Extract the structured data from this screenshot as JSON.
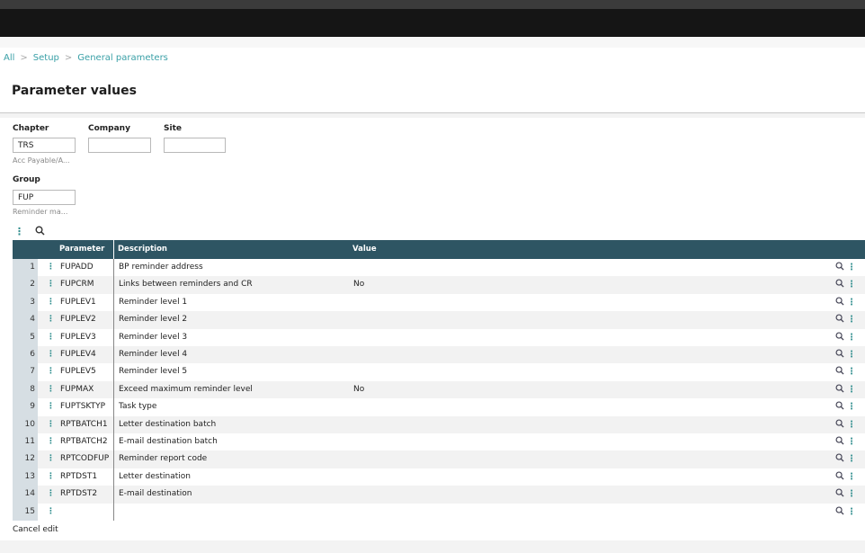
{
  "header": {
    "breadcrumb": [
      "All",
      "Setup",
      "General parameters"
    ],
    "title": "Parameter values"
  },
  "form": {
    "chapter": {
      "label": "Chapter",
      "value": "TRS",
      "description": "Acc Payable/A..."
    },
    "company": {
      "label": "Company",
      "value": ""
    },
    "site": {
      "label": "Site",
      "value": ""
    },
    "group": {
      "label": "Group",
      "value": "FUP",
      "description": "Reminder ma..."
    }
  },
  "table": {
    "columns": [
      "Parameter",
      "Description",
      "Value"
    ],
    "rows": [
      {
        "num": "1",
        "param": "FUPADD",
        "desc": "BP reminder address",
        "value": ""
      },
      {
        "num": "2",
        "param": "FUPCRM",
        "desc": "Links between reminders and CR",
        "value": "No"
      },
      {
        "num": "3",
        "param": "FUPLEV1",
        "desc": "Reminder level 1",
        "value": ""
      },
      {
        "num": "4",
        "param": "FUPLEV2",
        "desc": "Reminder level 2",
        "value": ""
      },
      {
        "num": "5",
        "param": "FUPLEV3",
        "desc": "Reminder level 3",
        "value": ""
      },
      {
        "num": "6",
        "param": "FUPLEV4",
        "desc": "Reminder level 4",
        "value": ""
      },
      {
        "num": "7",
        "param": "FUPLEV5",
        "desc": "Reminder level 5",
        "value": ""
      },
      {
        "num": "8",
        "param": "FUPMAX",
        "desc": "Exceed maximum reminder level",
        "value": "No"
      },
      {
        "num": "9",
        "param": "FUPTSKTYP",
        "desc": "Task type",
        "value": ""
      },
      {
        "num": "10",
        "param": "RPTBATCH1",
        "desc": "Letter destination batch",
        "value": ""
      },
      {
        "num": "11",
        "param": "RPTBATCH2",
        "desc": "E-mail destination batch",
        "value": ""
      },
      {
        "num": "12",
        "param": "RPTCODFUP",
        "desc": "Reminder report code",
        "value": ""
      },
      {
        "num": "13",
        "param": "RPTDST1",
        "desc": "Letter destination",
        "value": ""
      },
      {
        "num": "14",
        "param": "RPTDST2",
        "desc": "E-mail destination",
        "value": ""
      },
      {
        "num": "15",
        "param": "",
        "desc": "",
        "value": ""
      }
    ]
  },
  "footer": {
    "cancel_label": "Cancel edit"
  },
  "icons": {
    "row_search": "search-icon",
    "row_menu": "more-vertical-icon",
    "toolbar_menu": "more-vertical-icon",
    "toolbar_search": "search-icon"
  },
  "colors": {
    "header_bg": "#2e5563",
    "accent": "#2d8c8c",
    "link": "#3aa0a7"
  }
}
